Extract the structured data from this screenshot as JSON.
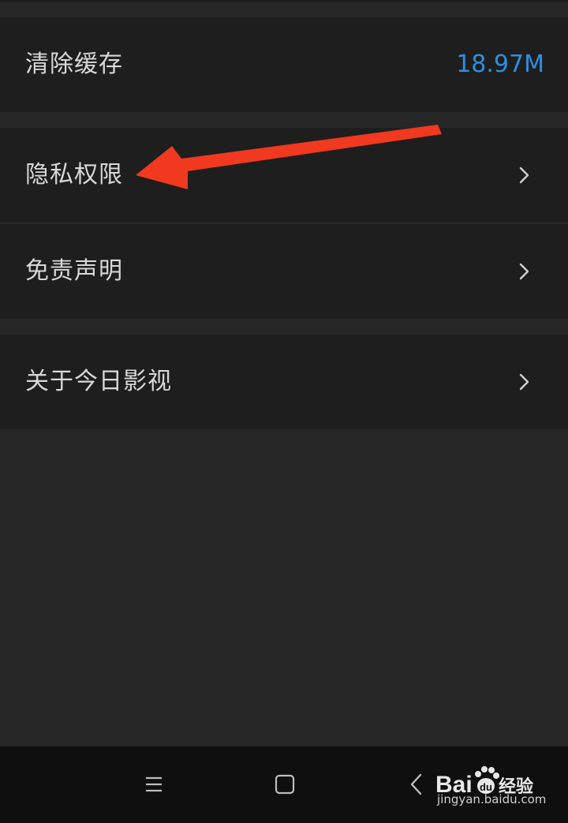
{
  "settings": {
    "clear_cache": {
      "label": "清除缓存",
      "value": "18.97M"
    },
    "privacy": {
      "label": "隐私权限"
    },
    "disclaimer": {
      "label": "免责声明"
    },
    "about": {
      "label": "关于今日影视"
    }
  },
  "watermark": {
    "brand_left": "Bai",
    "brand_right": "经验",
    "url": "jingyan.baidu.com"
  },
  "colors": {
    "accent_value": "#2e8fe0",
    "annotation_arrow": "#f0391f"
  },
  "icons": {
    "row_chevron": "chevron-right-icon",
    "nav_menu": "menu-icon",
    "nav_home": "home-icon",
    "nav_back": "back-icon"
  }
}
